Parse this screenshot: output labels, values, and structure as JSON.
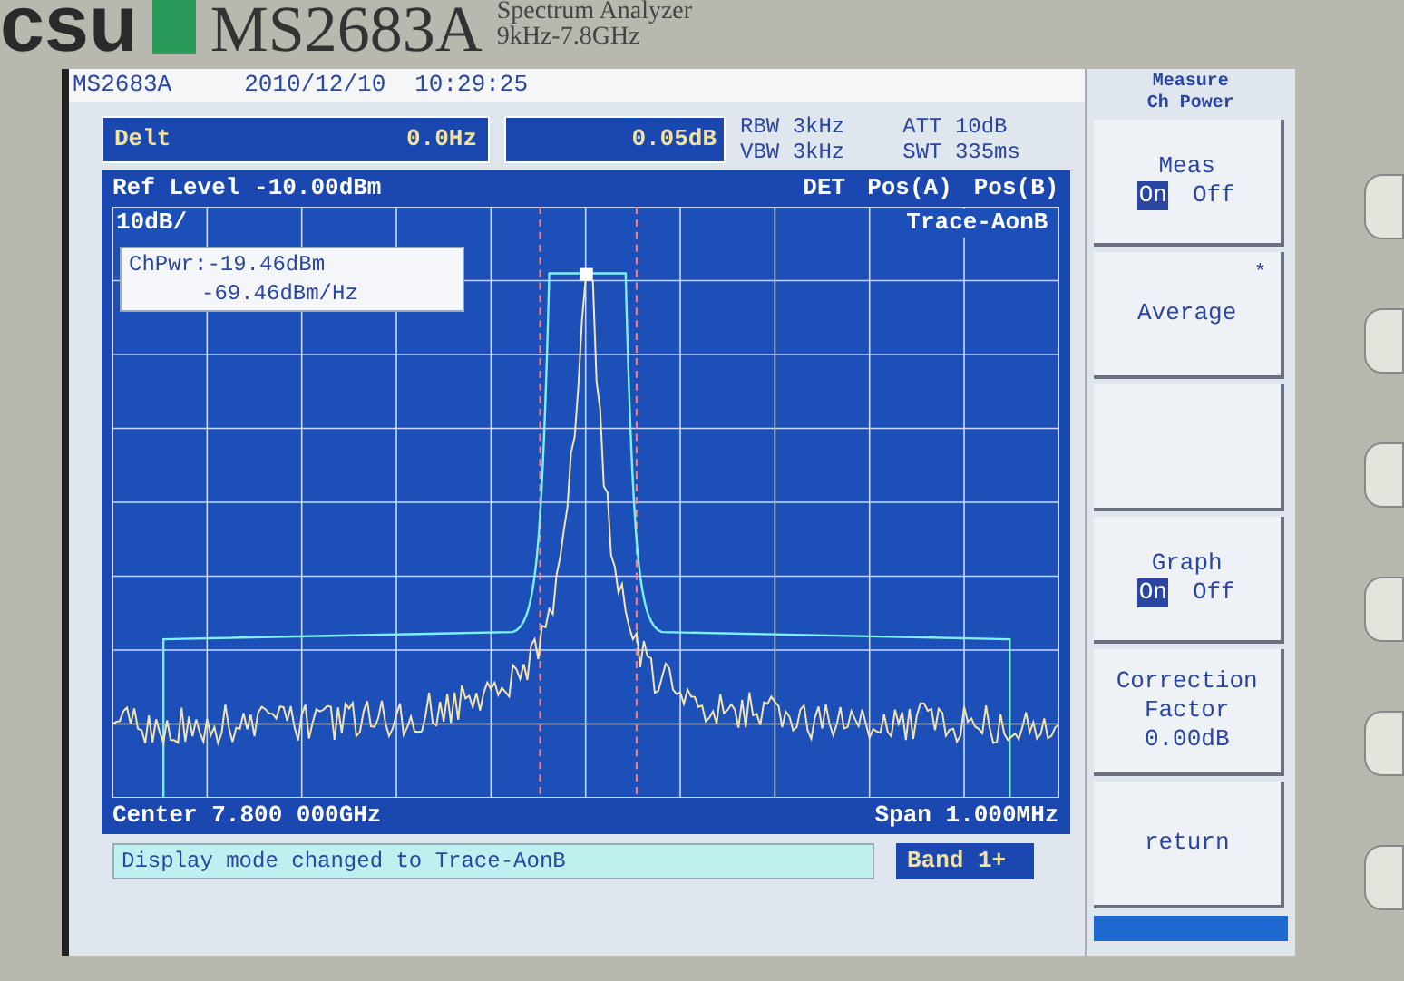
{
  "brand": {
    "logo_text": "csu",
    "model": "MS2683A",
    "product": "Spectrum Analyzer",
    "range": "9kHz-7.8GHz"
  },
  "title_bar": {
    "model": "MS2683A",
    "date": "2010/12/10",
    "time": "10:29:25"
  },
  "marker": {
    "label": "Delt",
    "frequency": "0.0Hz",
    "level": "0.05dB"
  },
  "settings": [
    {
      "name": "RBW",
      "value": "3kHz"
    },
    {
      "name": "VBW",
      "value": "3kHz"
    },
    {
      "name": "ATT",
      "value": "10dB"
    },
    {
      "name": "SWT",
      "value": "335ms"
    }
  ],
  "graph": {
    "ref_level": "Ref Level -10.00dBm",
    "detector": "DET",
    "pos_a": "Pos(A)",
    "pos_b": "Pos(B)",
    "scale": "10dB/",
    "trace_mode": "Trace-AonB",
    "readout": [
      "ChPwr:-19.46dBm",
      "-69.46dBm/Hz"
    ],
    "center": "Center 7.800 000GHz",
    "span": "Span 1.000MHz"
  },
  "message": "Display mode changed  to Trace-AonB",
  "band": "Band 1+",
  "softkeys": {
    "title": [
      "Measure",
      "Ch Power"
    ],
    "keys": [
      {
        "kind": "toggle",
        "label": "Meas",
        "options": [
          {
            "label": "On",
            "selected": true
          },
          {
            "label": "Off",
            "selected": false
          }
        ]
      },
      {
        "kind": "action",
        "lines": [
          "Average"
        ],
        "flag": "*"
      },
      {
        "kind": "blank"
      },
      {
        "kind": "toggle",
        "label": "Graph",
        "options": [
          {
            "label": "On",
            "selected": true
          },
          {
            "label": "Off",
            "selected": false
          }
        ]
      },
      {
        "kind": "action",
        "lines": [
          "Correction",
          "Factor",
          "0.00dB"
        ]
      },
      {
        "kind": "action",
        "lines": [
          "return"
        ]
      }
    ]
  }
}
